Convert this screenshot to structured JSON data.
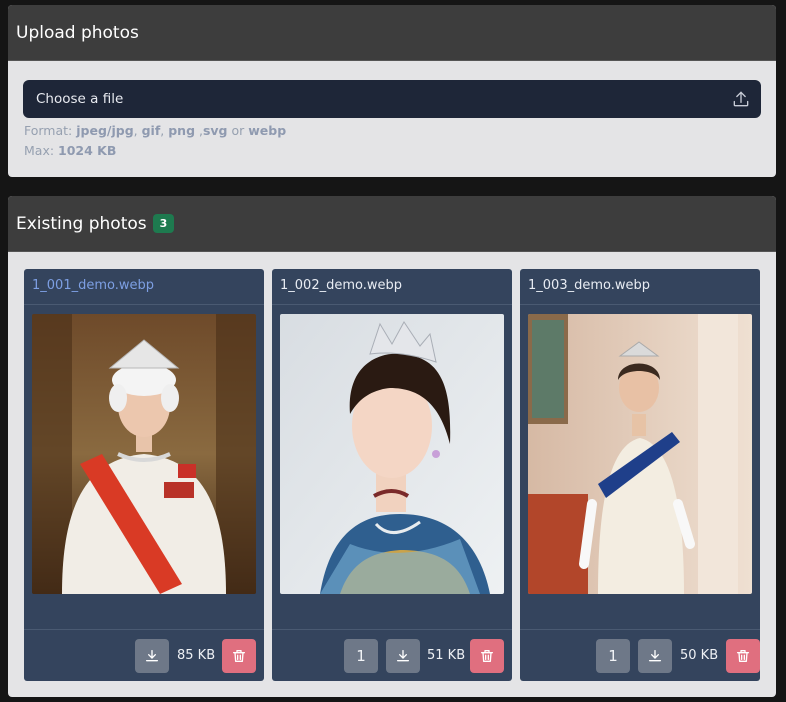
{
  "upload": {
    "title": "Upload photos",
    "placeholder": "Choose a file",
    "format_prefix": "Format: ",
    "format_jpeg": "jpeg/jpg",
    "format_sep1": ", ",
    "format_gif": "gif",
    "format_sep2": ", ",
    "format_png": "png",
    "format_sep3": " ,",
    "format_svg": "svg",
    "format_or": " or ",
    "format_webp": "webp",
    "max_prefix": "Max: ",
    "max_value": "1024 KB"
  },
  "existing": {
    "title": "Existing photos",
    "count": "3",
    "photos": [
      {
        "name": "1_001_demo.webp",
        "size": "85 KB"
      },
      {
        "name": "1_002_demo.webp",
        "size": "51 KB",
        "order": "1"
      },
      {
        "name": "1_003_demo.webp",
        "size": "50 KB",
        "order": "1"
      }
    ]
  },
  "icons": {
    "upload": "upload-icon",
    "download": "download-icon",
    "delete": "trash-icon"
  },
  "colors": {
    "header_bg": "#3d3d3d",
    "card_bg": "#34445d",
    "badge": "#1e7a4f",
    "delete_button": "#e06f7f",
    "link": "#7d9fe3"
  }
}
